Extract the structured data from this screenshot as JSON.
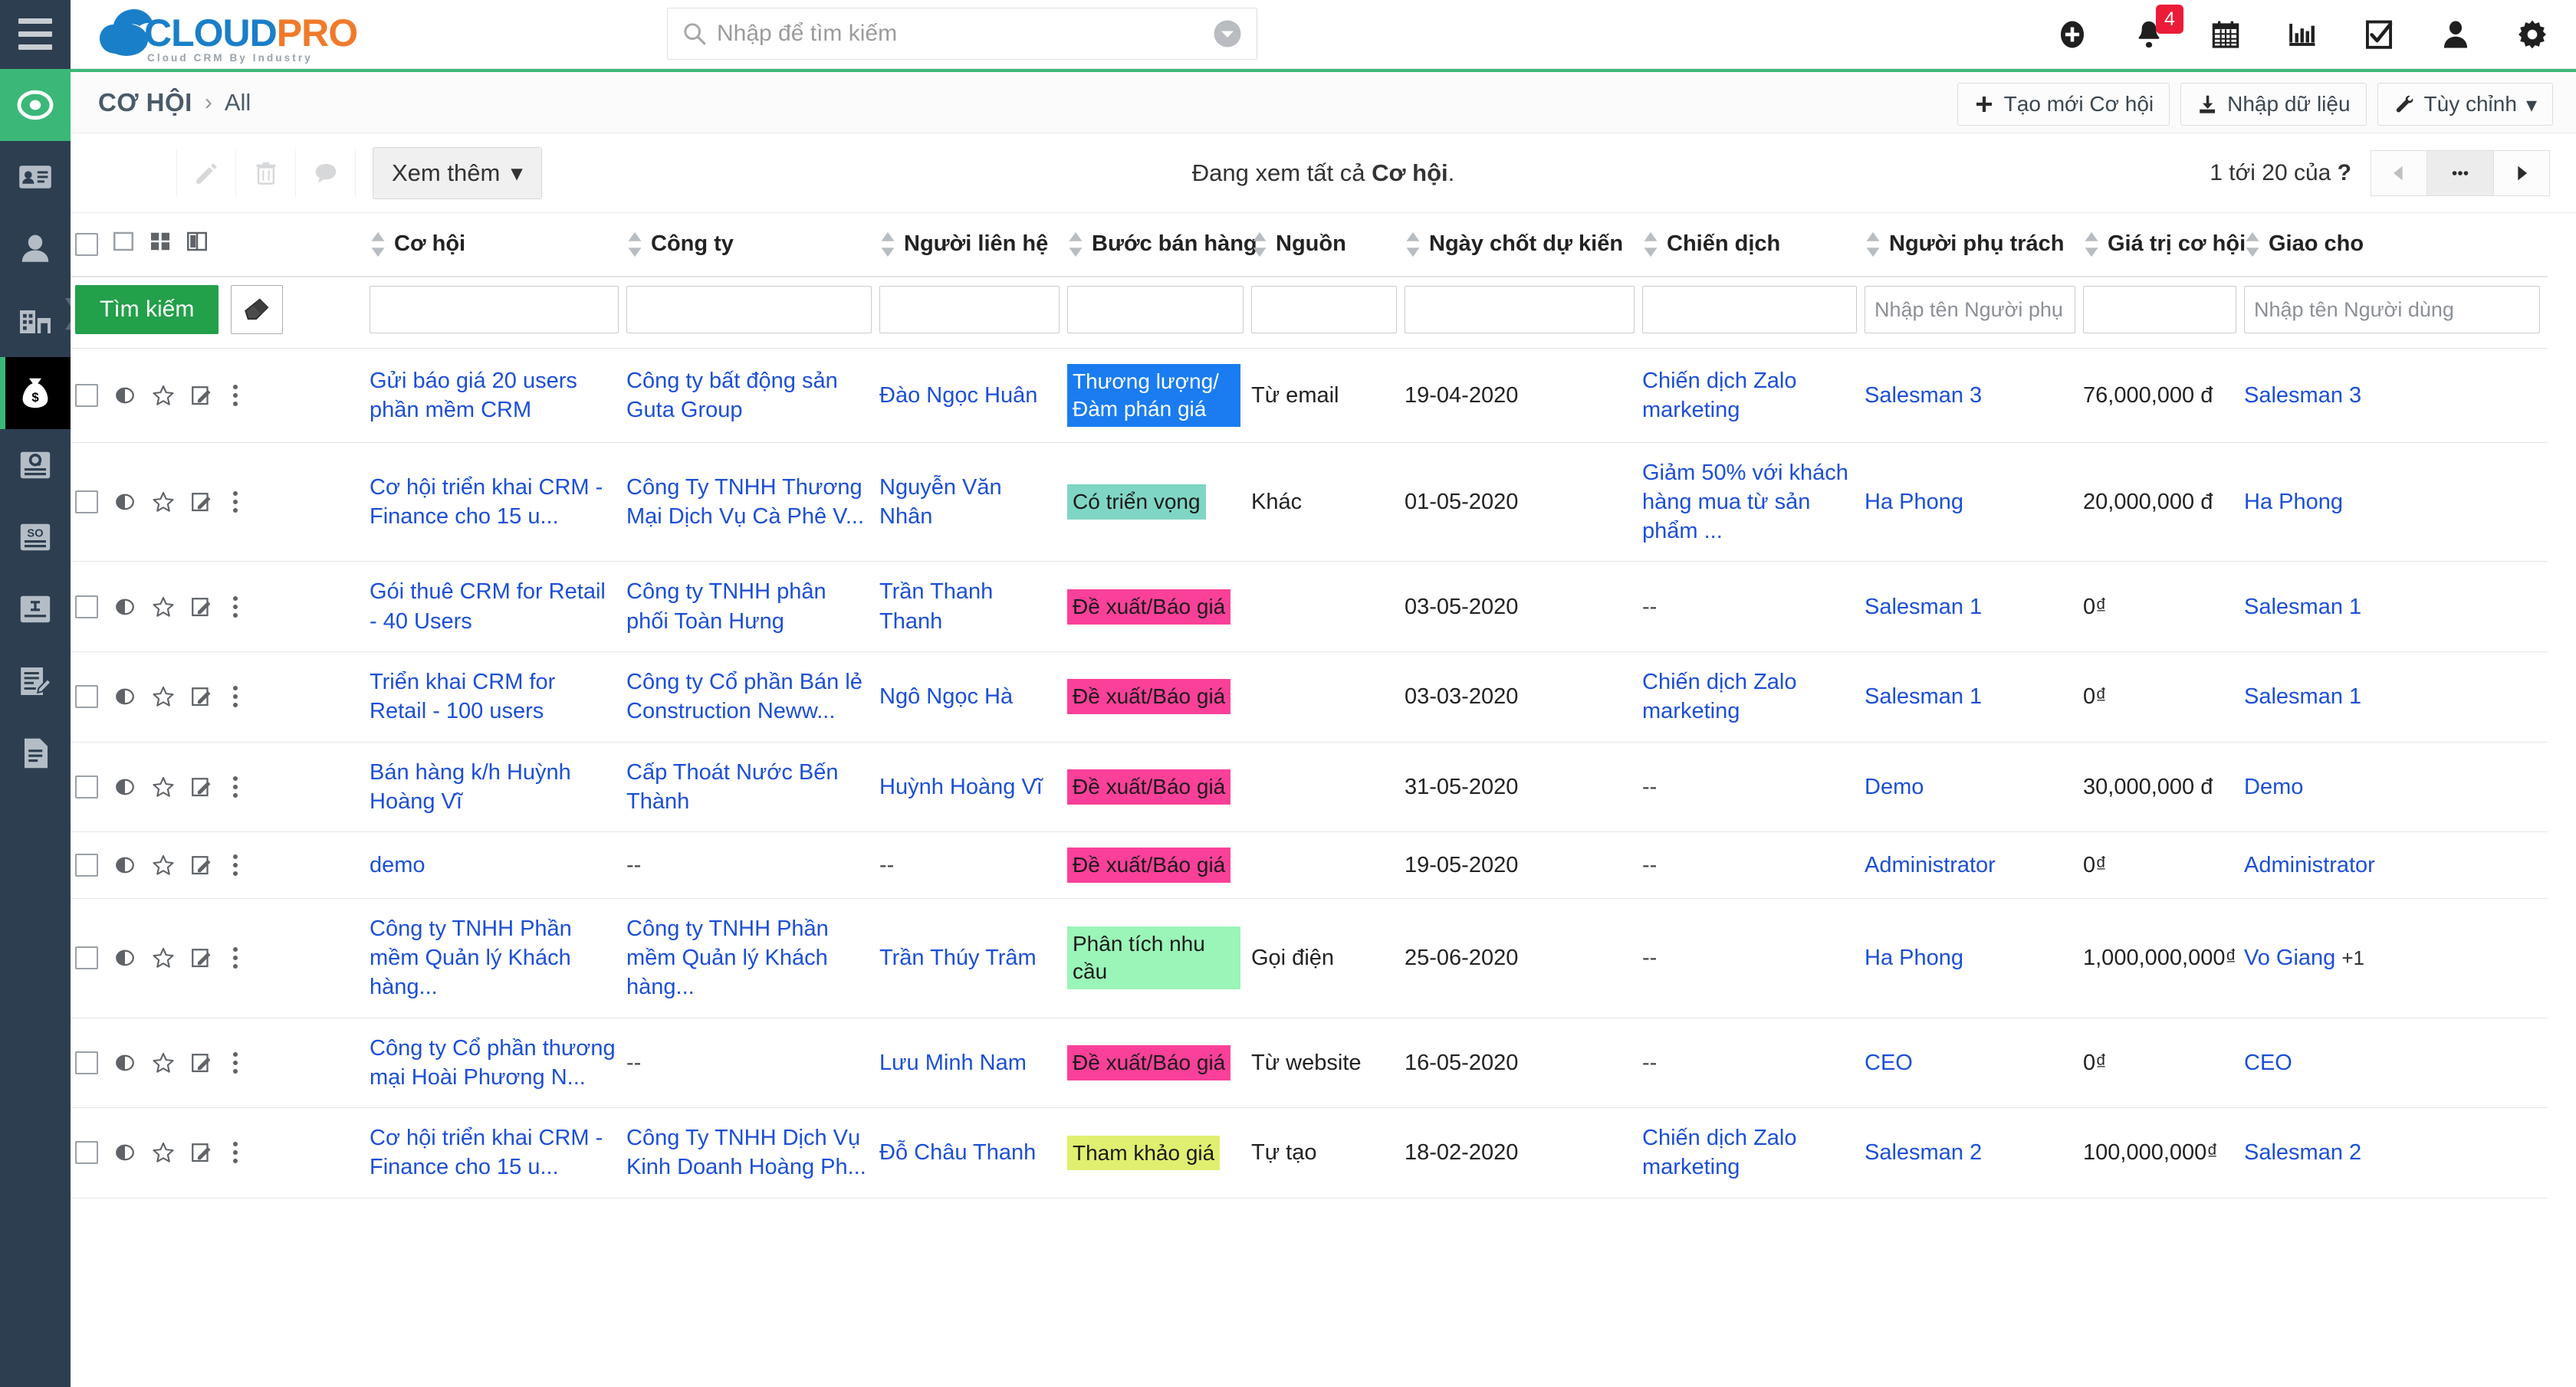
{
  "app": {
    "logo_main": "CLOUD",
    "logo_accent": "PRO",
    "logo_tagline": "Cloud CRM By Industry"
  },
  "search": {
    "placeholder": "Nhập để tìm kiếm",
    "value": ""
  },
  "topbar": {
    "icons": [
      {
        "name": "add-circle-icon",
        "label": "Tạo mới"
      },
      {
        "name": "bell-icon",
        "label": "Thông báo",
        "badge": "4"
      },
      {
        "name": "calendar-icon",
        "label": "Lịch"
      },
      {
        "name": "chart-icon",
        "label": "Báo cáo"
      },
      {
        "name": "checklist-icon",
        "label": "Công việc"
      },
      {
        "name": "user-icon",
        "label": "Tài khoản"
      },
      {
        "name": "gear-icon",
        "label": "Cài đặt"
      }
    ]
  },
  "rail": {
    "items": [
      {
        "name": "target-icon",
        "label": "Tổng quan",
        "state": "active-green"
      },
      {
        "name": "contact-card-icon",
        "label": "Danh thiếp",
        "state": ""
      },
      {
        "name": "person-icon",
        "label": "Khách hàng",
        "state": ""
      },
      {
        "name": "building-icon",
        "label": "Công ty",
        "state": ""
      },
      {
        "name": "money-bag-icon",
        "label": "Cơ hội",
        "state": "active-dark"
      },
      {
        "name": "quote-icon",
        "label": "Báo giá",
        "state": ""
      },
      {
        "name": "sales-order-icon",
        "label": "Đơn hàng",
        "state": ""
      },
      {
        "name": "invoice-icon",
        "label": "Hóa đơn",
        "state": ""
      },
      {
        "name": "contract-icon",
        "label": "Hợp đồng",
        "state": ""
      },
      {
        "name": "document-icon",
        "label": "Tài liệu",
        "state": ""
      }
    ],
    "expand_glyph": "❯"
  },
  "breadcrumb": {
    "module": "CƠ HỘI",
    "separator": "›",
    "view": "All"
  },
  "header_actions": [
    {
      "name": "create-opportunity-button",
      "label": "Tạo mới Cơ hội",
      "icon": "plus-icon"
    },
    {
      "name": "import-data-button",
      "label": "Nhập dữ liệu",
      "icon": "import-icon"
    },
    {
      "name": "customize-button",
      "label": "Tùy chỉnh",
      "icon": "wrench-icon",
      "caret": "▾"
    }
  ],
  "toolbar": {
    "edit_icon": "pencil-icon",
    "delete_icon": "trash-icon",
    "comment_icon": "comment-icon",
    "more_label": "Xem thêm",
    "more_caret": "▾",
    "status_prefix": "Đang xem tất cả ",
    "status_bold": "Cơ hội",
    "status_suffix": ".",
    "paging_text": "1 tới 20  của ",
    "paging_total": "?",
    "prev_icon": "prev-arrow-icon",
    "more_icon": "ellipsis-icon",
    "next_icon": "next-arrow-icon"
  },
  "table": {
    "view_icons": [
      {
        "name": "list-view-icon"
      },
      {
        "name": "grid-view-icon"
      },
      {
        "name": "split-view-icon"
      }
    ],
    "columns": [
      {
        "key": "opportunity",
        "label": "Cơ hội",
        "sortable": true
      },
      {
        "key": "company",
        "label": "Công ty",
        "sortable": true
      },
      {
        "key": "contact",
        "label": "Người liên hệ",
        "sortable": true
      },
      {
        "key": "stage",
        "label": "Bước bán hàng",
        "sortable": true
      },
      {
        "key": "source",
        "label": "Nguồn",
        "sortable": true
      },
      {
        "key": "close_date",
        "label": "Ngày chốt dự kiến",
        "sortable": true
      },
      {
        "key": "campaign",
        "label": "Chiến dịch",
        "sortable": true
      },
      {
        "key": "owner",
        "label": "Người phụ trách",
        "sortable": true
      },
      {
        "key": "value",
        "label": "Giá trị cơ hội",
        "sortable": true
      },
      {
        "key": "assigned",
        "label": "Giao cho",
        "sortable": true
      }
    ],
    "filters": {
      "search_label": "Tìm kiếm",
      "eraser_icon": "eraser-icon",
      "opportunity": "",
      "company": "",
      "contact": "",
      "stage": "",
      "source": "",
      "close_date": "",
      "campaign": "",
      "owner_placeholder": "Nhập tên Người phụ trách",
      "value": "",
      "assigned_placeholder": "Nhập tên Người dùng"
    },
    "rows": [
      {
        "opportunity": "Gửi báo giá 20 users phần mềm CRM",
        "company": "Công ty bất động sản Guta Group",
        "contact": "Đào Ngọc Huân",
        "stage": "Thương lượng/Đàm phán giá",
        "stage_bg": "#1a7cf0",
        "stage_fg": "#ffffff",
        "source": "Từ email",
        "close_date": "19-04-2020",
        "campaign": "Chiến dịch Zalo marketing",
        "owner": "Salesman 3",
        "value": "76,000,000 đ",
        "assigned": "Salesman 3",
        "assigned_extra": ""
      },
      {
        "opportunity": "Cơ hội triển khai CRM - Finance cho 15 u...",
        "company": "Công Ty TNHH Thương Mại Dịch Vụ Cà Phê V...",
        "contact": "Nguyễn Văn Nhân",
        "stage": "Có triển vọng",
        "stage_bg": "#7fd6c4",
        "stage_fg": "#1a1a1a",
        "source": "Khác",
        "close_date": "01-05-2020",
        "campaign": "Giảm 50% với khách hàng mua từ sản phẩm ...",
        "owner": "Ha Phong",
        "value": "20,000,000 đ",
        "assigned": "Ha Phong",
        "assigned_extra": ""
      },
      {
        "opportunity": "Gói thuê CRM for Retail - 40 Users",
        "company": "Công ty TNHH phân phối Toàn Hưng",
        "contact": "Trần Thanh Thanh",
        "stage": "Đề xuất/Báo giá",
        "stage_bg": "#fa4099",
        "stage_fg": "#1a1a1a",
        "source": "",
        "close_date": "03-05-2020",
        "campaign": "--",
        "owner": "Salesman 1",
        "value": "0₫",
        "assigned": "Salesman 1",
        "assigned_extra": ""
      },
      {
        "opportunity": "Triển khai CRM for Retail - 100 users",
        "company": "Công ty Cổ phần Bán lẻ Construction Neww...",
        "contact": "Ngô Ngọc Hà",
        "stage": "Đề xuất/Báo giá",
        "stage_bg": "#fa4099",
        "stage_fg": "#1a1a1a",
        "source": "",
        "close_date": "03-03-2020",
        "campaign": "Chiến dịch Zalo marketing",
        "owner": "Salesman 1",
        "value": "0₫",
        "assigned": "Salesman 1",
        "assigned_extra": ""
      },
      {
        "opportunity": "Bán hàng k/h Huỳnh Hoàng Vĩ",
        "company": "Cấp Thoát Nước Bến Thành",
        "contact": "Huỳnh Hoàng Vĩ",
        "stage": "Đề xuất/Báo giá",
        "stage_bg": "#fa4099",
        "stage_fg": "#1a1a1a",
        "source": "",
        "close_date": "31-05-2020",
        "campaign": "--",
        "owner": "Demo",
        "value": "30,000,000 đ",
        "assigned": "Demo",
        "assigned_extra": ""
      },
      {
        "opportunity": "demo",
        "company": "--",
        "contact": "--",
        "stage": "Đề xuất/Báo giá",
        "stage_bg": "#fa4099",
        "stage_fg": "#1a1a1a",
        "source": "",
        "close_date": "19-05-2020",
        "campaign": "--",
        "owner": "Administrator",
        "value": "0₫",
        "assigned": "Administrator",
        "assigned_extra": ""
      },
      {
        "opportunity": "Công ty TNHH Phần mềm Quản lý Khách hàng...",
        "company": "Công ty TNHH Phần mềm Quản lý Khách hàng...",
        "contact": "Trần Thúy Trâm",
        "stage": "Phân tích nhu cầu",
        "stage_bg": "#9af5b8",
        "stage_fg": "#1a1a1a",
        "source": "Gọi điện",
        "close_date": "25-06-2020",
        "campaign": "--",
        "owner": "Ha Phong",
        "value": "1,000,000,000₫",
        "assigned": "Vo Giang",
        "assigned_extra": "+1"
      },
      {
        "opportunity": "Công ty Cổ phần thương mại Hoài Phương N...",
        "company": "--",
        "contact": "Lưu Minh Nam",
        "stage": "Đề xuất/Báo giá",
        "stage_bg": "#fa4099",
        "stage_fg": "#1a1a1a",
        "source": "Từ website",
        "close_date": "16-05-2020",
        "campaign": "--",
        "owner": "CEO",
        "value": "0₫",
        "assigned": "CEO",
        "assigned_extra": ""
      },
      {
        "opportunity": "Cơ hội triển khai CRM - Finance cho 15 u...",
        "company": "Công Ty TNHH Dịch Vụ Kinh Doanh Hoàng Ph...",
        "contact": "Đỗ Châu Thanh",
        "stage": "Tham khảo giá",
        "stage_bg": "#e1ef70",
        "stage_fg": "#1a1a1a",
        "source": "Tự tạo",
        "close_date": "18-02-2020",
        "campaign": "Chiến dịch Zalo marketing",
        "owner": "Salesman 2",
        "value": "100,000,000₫",
        "assigned": "Salesman 2",
        "assigned_extra": ""
      }
    ]
  },
  "colors": {
    "brand_blue": "#1a7fc9",
    "brand_orange": "#f07a2a",
    "accent_green": "#3bb878",
    "sidebar": "#2d3e50",
    "link": "#1c4fd8",
    "badge_red": "#ec1c38",
    "search_button": "#23a04a"
  }
}
